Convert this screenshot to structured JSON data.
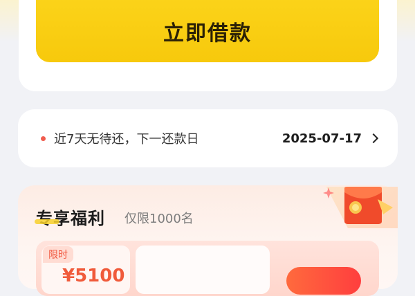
{
  "borrow": {
    "button_label": "立即借款"
  },
  "repayment": {
    "notice": "近7天无待还，下一还款日",
    "next_date": "2025-07-17"
  },
  "benefits": {
    "title": "专享福利",
    "subtitle": "仅限1000名",
    "coupon": {
      "tag": "限时",
      "amount": "¥5100"
    }
  },
  "colors": {
    "accent_yellow": "#f7c90c",
    "alert_red": "#f05c4e",
    "promo_red": "#f05a3a"
  },
  "icons": {
    "repayment_chevron": "chevron-right-icon",
    "benefit_gift": "red-envelope-gift-icon"
  }
}
